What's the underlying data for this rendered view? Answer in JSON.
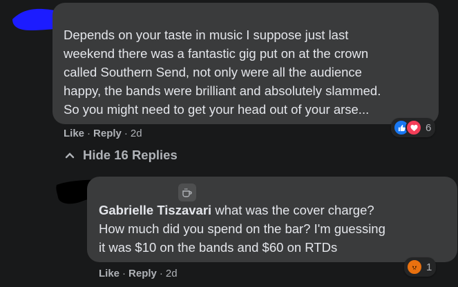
{
  "comment": {
    "text_lines": [
      "Depends on your taste in music I suppose just last",
      "weekend there was a fantastic gig put on at the crown",
      "called Southern Send, not only were all the audience",
      "happy, the bands were brilliant and absolutely slammed.",
      "So you might need to get your head out of your arse..."
    ],
    "actions": {
      "like": "Like",
      "reply": "Reply",
      "time": "2d"
    },
    "reactions": {
      "icons": [
        "like-icon",
        "love-icon"
      ],
      "count": "6"
    }
  },
  "hide_replies": {
    "label": "Hide 16 Replies"
  },
  "reply": {
    "author": "Gabrielle Tiszavari",
    "text_first": "what was the cover charge?",
    "text_lines": [
      "How much did you spend on the bar? I'm guessing",
      "it was $10 on the bands and $60 on RTDs"
    ],
    "actions": {
      "like": "Like",
      "reply": "Reply",
      "time": "2d"
    },
    "reactions": {
      "icons": [
        "angry-icon"
      ],
      "count": "1"
    }
  },
  "colors": {
    "background": "#18191a",
    "bubble": "#3a3b3c",
    "text": "#e4e6eb",
    "muted": "#b0b3b8",
    "like_blue": "#1877f2",
    "love_red": "#f33e58",
    "angry_orange": "#e9710f",
    "redaction_blue": "#1c1cff"
  }
}
